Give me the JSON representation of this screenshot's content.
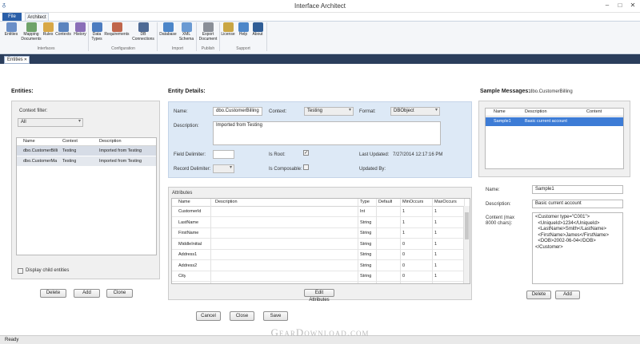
{
  "window": {
    "title": "Interface Architect",
    "minimize": "–",
    "maximize": "□",
    "close": "✕"
  },
  "ribbon": {
    "tabs": [
      "File",
      "Architect"
    ],
    "buttons": [
      {
        "label": "Entities",
        "icon": "entities-icon",
        "color": "#6a8fc8"
      },
      {
        "label": "Mapping Documents",
        "icon": "mapping-documents-icon",
        "color": "#6fa36a"
      },
      {
        "label": "Rules",
        "icon": "rules-icon",
        "color": "#d8a847"
      },
      {
        "label": "Contexts",
        "icon": "contexts-icon",
        "color": "#5b84bf"
      },
      {
        "label": "History",
        "icon": "history-icon",
        "color": "#8a6fb8"
      },
      {
        "label": "Data Types",
        "icon": "data-types-icon",
        "color": "#4c7cc0"
      },
      {
        "label": "Requirements",
        "icon": "requirements-icon",
        "color": "#c0664c"
      },
      {
        "label": "DB Connections",
        "icon": "db-connections-icon",
        "color": "#4e6a95"
      },
      {
        "label": "Database",
        "icon": "database-icon",
        "color": "#4c86c9"
      },
      {
        "label": "XML Schema",
        "icon": "xml-schema-icon",
        "color": "#6a9ad3"
      },
      {
        "label": "Export Document",
        "icon": "export-document-icon",
        "color": "#8a8f98"
      },
      {
        "label": "License",
        "icon": "license-icon",
        "color": "#c9a644"
      },
      {
        "label": "Help",
        "icon": "help-icon",
        "color": "#4c86c9"
      },
      {
        "label": "About",
        "icon": "about-icon",
        "color": "#2f5d96"
      }
    ],
    "groups": [
      "Interfaces",
      "Configuration",
      "Import",
      "Publish",
      "Support"
    ]
  },
  "doc_tab": {
    "label": "Entities",
    "close": "✕"
  },
  "entities": {
    "heading": "Entities:",
    "context_filter_label": "Context filter:",
    "context_filter_value": "All",
    "columns": [
      "Name",
      "Context",
      "Description"
    ],
    "rows": [
      [
        "dbo.CustomerBilli",
        "Testing",
        "Imported from Testing"
      ],
      [
        "dbo.CustomerMa",
        "Testing",
        "Imported from Testing"
      ]
    ],
    "display_child": "Display child entities",
    "delete": "Delete",
    "add": "Add",
    "clone": "Clone"
  },
  "details": {
    "heading": "Entity Details:",
    "name_label": "Name:",
    "name_value": "dbo.CustomerBilling",
    "context_label": "Context:",
    "context_value": "Testing",
    "format_label": "Format:",
    "format_value": "DBObject",
    "description_label": "Description:",
    "description_value": "Imported from Testing",
    "field_delim_label": "Field Delimiter:",
    "record_delim_label": "Record Delimiter:",
    "is_root_label": "Is Root:",
    "is_root_check": "✓",
    "is_composable_label": "Is Composable:",
    "last_updated_label": "Last Updated:",
    "last_updated_value": "7/27/2014 12:17:16 PM",
    "updated_by_label": "Updated By:"
  },
  "attributes": {
    "heading": "Attributes",
    "columns": [
      "Name",
      "Description",
      "Type",
      "Default",
      "MinOccurs",
      "MaxOccurs"
    ],
    "rows": [
      [
        "CustomerId",
        "",
        "Int",
        "",
        "1",
        "1"
      ],
      [
        "LastName",
        "",
        "String",
        "",
        "1",
        "1"
      ],
      [
        "FirstName",
        "",
        "String",
        "",
        "1",
        "1"
      ],
      [
        "MiddleInitial",
        "",
        "String",
        "",
        "0",
        "1"
      ],
      [
        "Address1",
        "",
        "String",
        "",
        "0",
        "1"
      ],
      [
        "Address2",
        "",
        "String",
        "",
        "0",
        "1"
      ],
      [
        "City",
        "",
        "String",
        "",
        "0",
        "1"
      ]
    ],
    "edit": "Edit Attributes"
  },
  "buttons": {
    "cancel": "Cancel",
    "close": "Close",
    "save": "Save"
  },
  "samples": {
    "heading": "Sample Messages:",
    "entity": "dbo.CustomerBilling",
    "columns": [
      "Name",
      "Description",
      "Content"
    ],
    "rows": [
      [
        "Sample1",
        "Basic current account",
        ""
      ]
    ],
    "name_label": "Name:",
    "name_value": "Sample1",
    "desc_label": "Description:",
    "desc_value": "Basic current account",
    "content_label": "Content (max 8000 chars):",
    "content_lines": [
      "<Customer type=\"C001\">",
      "  <UniqueId>1234</UniqueId>",
      "  <LastName>Smith</LastName>",
      "  <FirstName>James</FirstName>",
      "  <DOB>2002-06-04</DOB>",
      "</Customer>"
    ],
    "delete": "Delete",
    "add": "Add"
  },
  "status": "Ready",
  "watermark": "GearDownload.com"
}
